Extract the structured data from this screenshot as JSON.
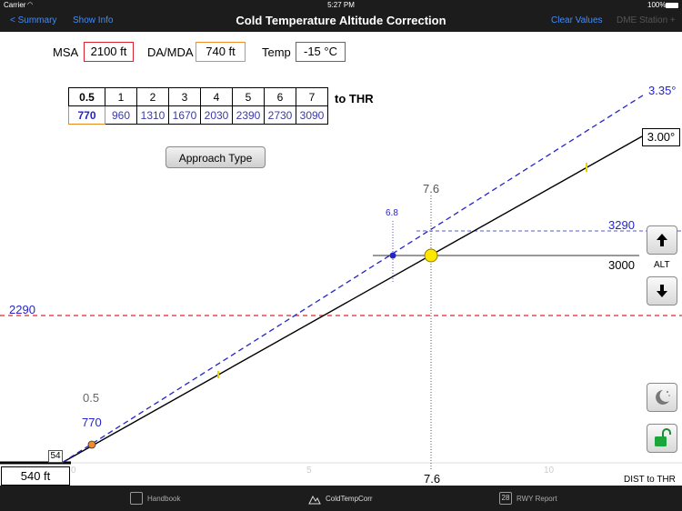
{
  "status": {
    "carrier": "Carrier",
    "time": "5:27 PM",
    "battery": "100%"
  },
  "nav": {
    "back": "< Summary",
    "show_info": "Show Info",
    "title": "Cold Temperature Altitude Correction",
    "clear_values": "Clear Values",
    "dme_station": "DME Station +"
  },
  "inputs": {
    "msa_label": "MSA",
    "msa_value": "2100 ft",
    "da_label": "DA/MDA",
    "da_value": "740 ft",
    "temp_label": "Temp",
    "temp_value": "-15 °C"
  },
  "colors": {
    "msa_border": "#d9242b",
    "da_border": "#f28c28",
    "blue": "#2424c8",
    "red": "#e0252d",
    "gold": "#ffe800"
  },
  "distance_table": {
    "distances": [
      "0.5",
      "1",
      "2",
      "3",
      "4",
      "5",
      "6",
      "7"
    ],
    "altitudes": [
      "770",
      "960",
      "1310",
      "1670",
      "2030",
      "2390",
      "2730",
      "3090"
    ],
    "suffix": "to THR"
  },
  "approach_button": "Approach Type",
  "chart": {
    "corrected_angle_label": "3.35°",
    "nominal_angle_label": "3.00°",
    "selected_distance_top": "7.6",
    "selected_distance_bottom": "7.6",
    "corrected_point_distance": "6.8",
    "corrected_altitude": "3290",
    "altitude": "3000",
    "msa_corrected": "2290",
    "threshold_distance": "0.5",
    "threshold_altitude": "770",
    "threshold_elevation": "540 ft",
    "small_box_value": "54",
    "x_ticks": [
      "0",
      "5",
      "10"
    ],
    "x_axis_label": "DIST to THR",
    "alt_label": "ALT"
  },
  "chart_data": {
    "type": "line",
    "x": [
      0,
      5,
      10
    ],
    "series": [
      {
        "name": "3.00°",
        "values": [
          540,
          1500,
          3000
        ]
      },
      {
        "name": "3.35°",
        "values": [
          540,
          2030,
          3290
        ]
      }
    ]
  },
  "side_buttons": {
    "up": "up-arrow-icon",
    "down": "down-arrow-icon",
    "night": "moon-icon",
    "lock": "unlock-icon"
  },
  "tabs": [
    {
      "label": "Handbook",
      "icon": "book-icon"
    },
    {
      "label": "ColdTempCorr",
      "icon": "mountain-icon"
    },
    {
      "label": "RWY Report",
      "icon": "runway-report-icon",
      "icon_text": "28"
    }
  ]
}
